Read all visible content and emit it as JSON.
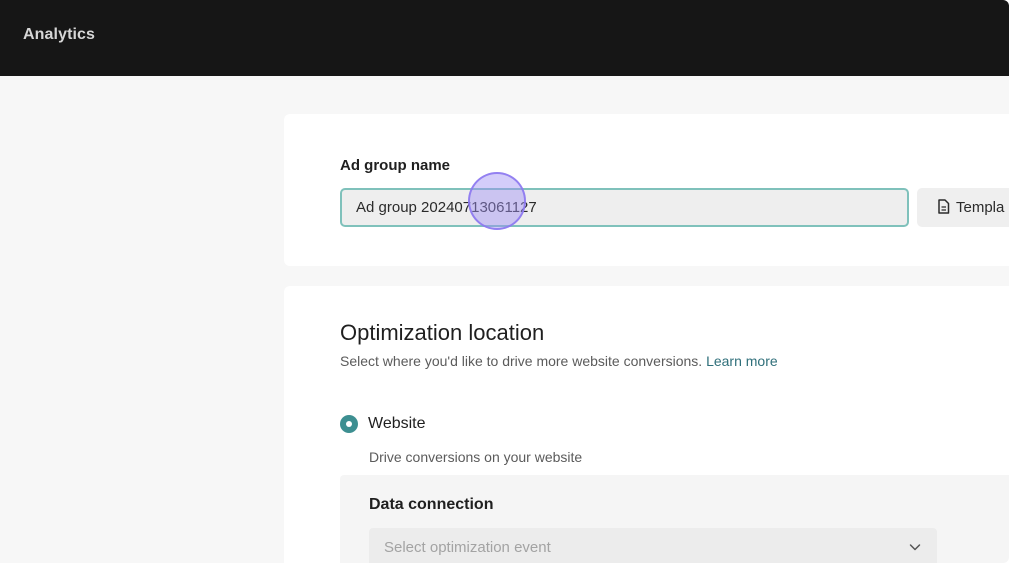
{
  "app": {
    "title": "Analytics"
  },
  "ad_group": {
    "label": "Ad group name",
    "value": "Ad group 20240713061127",
    "template_label": "Templa"
  },
  "optimization": {
    "title": "Optimization location",
    "description": "Select where you'd like to drive more website conversions.",
    "learn_more": "Learn more",
    "option": {
      "label": "Website",
      "description": "Drive conversions on your website",
      "selected": true
    },
    "data_connection": {
      "title": "Data connection",
      "select_placeholder": "Select optimization event"
    }
  },
  "colors": {
    "topbar": "#161616",
    "accent": "#3d8f91",
    "link": "#2f6f7a",
    "input_border": "#7fc1bb",
    "cursor": "#a091f5"
  },
  "icons": {
    "template": "document-icon",
    "select": "chevron-down-icon"
  }
}
